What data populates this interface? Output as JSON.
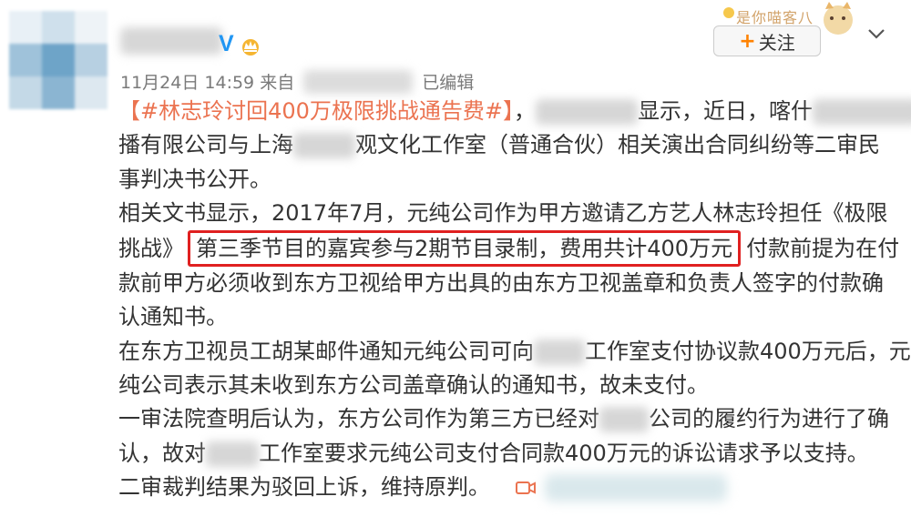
{
  "post": {
    "verified_badge": "V",
    "time": "11月24日 14:59",
    "source_prefix": "来自",
    "edited": "已编辑"
  },
  "header": {
    "decoration_text": "是你喵客八",
    "follow_plus": "+",
    "follow_label": "关注"
  },
  "content": {
    "topic": "【#林志玲讨回400万极限挑战通告费#】",
    "l1_a": "，",
    "l1_b": "显示，近日，喀什",
    "l1_c": "传",
    "l2_a": "播有限公司与上海",
    "l2_b": "观文化工作室（普通合伙）相关演出合同纠纷等二审民",
    "l3": "事判决书公开。",
    "l4": "相关文书显示，2017年7月，元纯公司作为甲方邀请乙方艺人林志玲担任《极限",
    "l5_a": "挑战》",
    "l5_highlight": "第三季节目的嘉宾参与2期节目录制，费用共计400万元",
    "l5_b": "付款前提为在付",
    "l6": "款前甲方必须收到东方卫视给甲方出具的由东方卫视盖章和负责人签字的付款确",
    "l7": "认通知书。",
    "l8_a": "在东方卫视员工胡某邮件通知元纯公司可向",
    "l8_b": "工作室支付协议款400万元后，元",
    "l9": "纯公司表示其未收到东方公司盖章确认的通知书，故未支付。",
    "l10_a": "一审法院查明后认为，东方公司作为第三方已经对",
    "l10_b": "公司的履约行为进行了确",
    "l11_a": "认，故对",
    "l11_b": "工作室要求元纯公司支付合同款400万元的诉讼请求予以支持。",
    "l12": "二审裁判结果为驳回上诉，维持原判。"
  },
  "icons": {
    "crown": "crown-icon",
    "chevron": "chevron-down-icon",
    "video": "video-icon"
  },
  "colors": {
    "topic": "#eb7350",
    "highlight_border": "#e02020",
    "follow_plus": "#ff8200",
    "verified": "#2196f3"
  }
}
